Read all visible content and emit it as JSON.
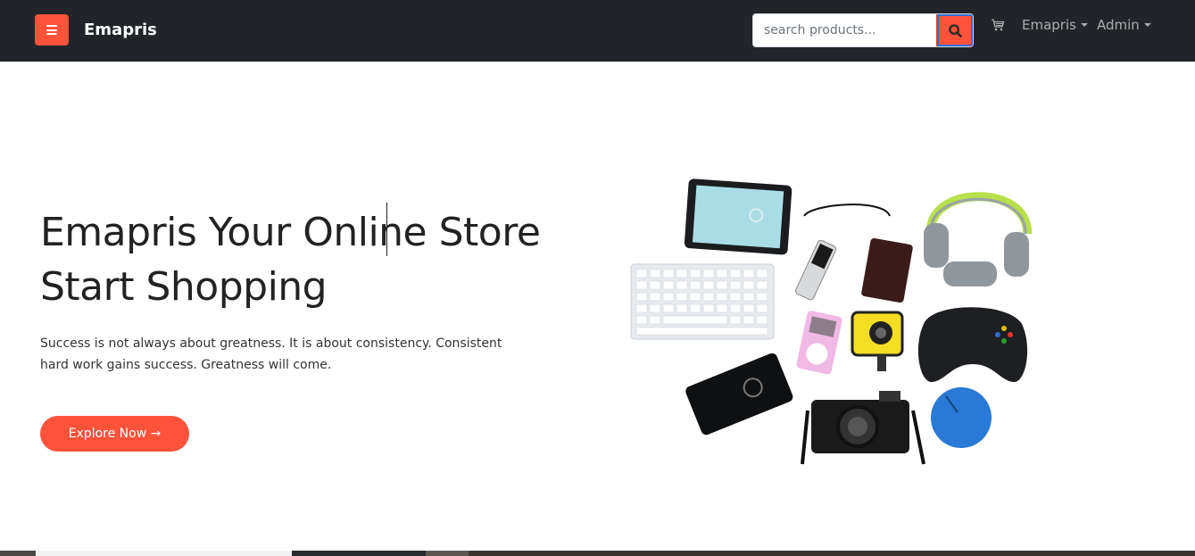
{
  "navbar": {
    "brand": "Emapris",
    "search": {
      "placeholder": "search products...",
      "value": ""
    },
    "menus": [
      {
        "label": "Emapris"
      },
      {
        "label": "Admin"
      }
    ],
    "icons": {
      "menu": "menu-bars-icon",
      "search": "search-icon",
      "cart": "cart-icon"
    }
  },
  "hero": {
    "title_line1": "Emapris Your Online Store",
    "title_line2": "Start Shopping",
    "description": "Success is not always about greatness. It is about consistency. Consistent hard work gains success. Greatness will come.",
    "cta_label": "Explore Now →",
    "image": "electronics-collage"
  },
  "colors": {
    "accent": "#ff523b",
    "navbar": "#212529",
    "text": "#222222"
  }
}
